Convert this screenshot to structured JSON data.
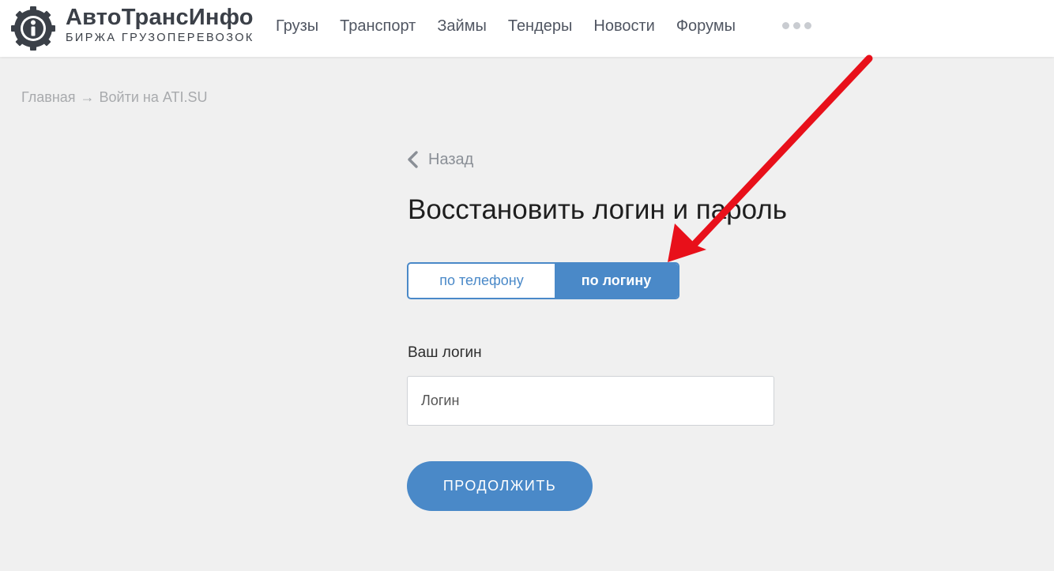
{
  "header": {
    "brand_name": "АвтоТрансИнфо",
    "brand_subtitle": "БИРЖА ГРУЗОПЕРЕВОЗОК",
    "logo_icon": "info-gear-icon",
    "nav": [
      "Грузы",
      "Транспорт",
      "Займы",
      "Тендеры",
      "Новости",
      "Форумы"
    ],
    "more_icon": "more-dots-icon"
  },
  "breadcrumb": {
    "home": "Главная",
    "separator": "→",
    "current": "Войти на ATI.SU"
  },
  "back": {
    "label": "Назад",
    "icon": "chevron-left-icon"
  },
  "title": "Восстановить логин и пароль",
  "toggle": {
    "option_phone": "по телефону",
    "option_login": "по логину",
    "selected": "по логину"
  },
  "form": {
    "login_label": "Ваш логин",
    "login_placeholder": "Логин",
    "login_value": "",
    "submit_label": "ПРОДОЛЖИТЬ"
  },
  "colors": {
    "accent": "#4a89c8",
    "page_bg": "#f0f0f0",
    "header_bg": "#ffffff",
    "annotation_arrow": "#e8101a"
  }
}
